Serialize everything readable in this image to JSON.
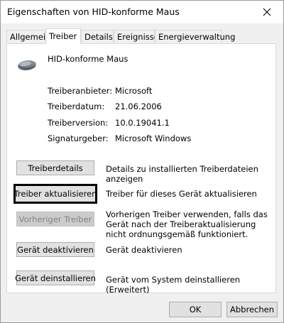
{
  "window": {
    "title": "Eigenschaften von HID-konforme Maus",
    "close_icon": "close-icon"
  },
  "tabs": [
    {
      "label": "Allgemein",
      "active": false
    },
    {
      "label": "Treiber",
      "active": true
    },
    {
      "label": "Details",
      "active": false
    },
    {
      "label": "Ereignisse",
      "active": false
    },
    {
      "label": "Energieverwaltung",
      "active": false
    }
  ],
  "device": {
    "name": "HID-konforme Maus",
    "icon": "mouse-icon"
  },
  "info": [
    {
      "label": "Treiberanbieter:",
      "value": "Microsoft"
    },
    {
      "label": "Treiberdatum:",
      "value": "21.06.2006"
    },
    {
      "label": "Treiberversion:",
      "value": "10.0.19041.1"
    },
    {
      "label": "Signaturgeber:",
      "value": "Microsoft Windows"
    }
  ],
  "actions": [
    {
      "button": "Treiberdetails",
      "description": "Details zu installierten Treiberdateien anzeigen",
      "enabled": true,
      "focused": false
    },
    {
      "button": "Treiber aktualisieren",
      "description": "Treiber für dieses Gerät aktualisieren",
      "enabled": true,
      "focused": true
    },
    {
      "button": "Vorheriger Treiber",
      "description": "Vorherigen Treiber verwenden, falls das Gerät nach der Treiberaktualisierung nicht ordnungsgemäß funktioniert.",
      "enabled": false,
      "focused": false
    },
    {
      "button": "Gerät deaktivieren",
      "description": "Gerät deaktivieren",
      "enabled": true,
      "focused": false
    },
    {
      "button": "Gerät deinstallieren",
      "description": "Gerät vom System deinstallieren (Erweitert)",
      "enabled": true,
      "focused": false
    }
  ],
  "footer": {
    "ok_label": "OK",
    "cancel_label": "Abbrechen"
  }
}
